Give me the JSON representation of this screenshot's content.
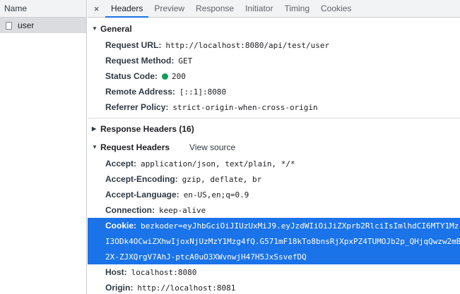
{
  "request_list": {
    "header": "Name",
    "items": [
      {
        "name": "user"
      }
    ]
  },
  "tabs": [
    "Headers",
    "Preview",
    "Response",
    "Initiator",
    "Timing",
    "Cookies"
  ],
  "close_label": "×",
  "general": {
    "title": "General",
    "rows": [
      {
        "key": "Request URL:",
        "value": "http://localhost:8080/api/test/user"
      },
      {
        "key": "Request Method:",
        "value": "GET"
      },
      {
        "key": "Status Code:",
        "value": "200"
      },
      {
        "key": "Remote Address:",
        "value": "[::1]:8080"
      },
      {
        "key": "Referrer Policy:",
        "value": "strict-origin-when-cross-origin"
      }
    ]
  },
  "response_headers": {
    "title": "Response Headers (16)"
  },
  "request_headers": {
    "title": "Request Headers",
    "view_source": "View source",
    "rows": [
      {
        "key": "Accept:",
        "value": "application/json, text/plain, */*"
      },
      {
        "key": "Accept-Encoding:",
        "value": "gzip, deflate, br"
      },
      {
        "key": "Accept-Language:",
        "value": "en-US,en;q=0.9"
      },
      {
        "key": "Connection:",
        "value": "keep-alive"
      }
    ],
    "cookie": {
      "key": "Cookie:",
      "line1": "bezkoder=eyJhbGciOiJIUzUxMiJ9.eyJzdWIiOiJiZXprb2RlciIsImlhdCI6MTY1Mz",
      "line2": "I3ODk4OCwiZXhwIjoxNjUzMzY1Mzg4fQ.G571mF18kTo8bnsRjXpxPZ4TUMOJb2p_QHjqQwzw2mB",
      "line3": "2X-ZJXQrgV7AhJ-ptcA0uO3XWvnwjH47H5JxSsvefDQ"
    },
    "rows_after": [
      {
        "key": "Host:",
        "value": "localhost:8080"
      },
      {
        "key": "Origin:",
        "value": "http://localhost:8081"
      }
    ]
  },
  "colors": {
    "accent": "#1a73e8",
    "status_ok": "#0f9d58"
  }
}
